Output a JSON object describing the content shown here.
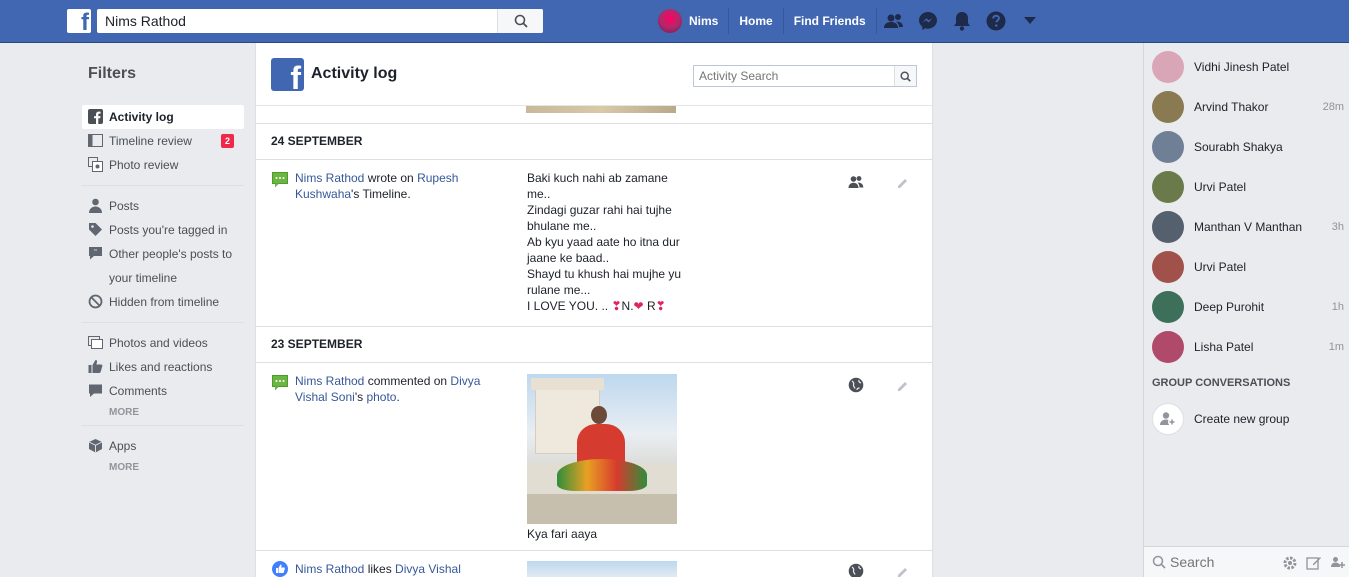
{
  "topbar": {
    "search_value": "Nims Rathod",
    "profile_name": "Nims",
    "nav_home": "Home",
    "nav_find_friends": "Find Friends"
  },
  "filters": {
    "title": "Filters",
    "items": {
      "activity_log": "Activity log",
      "timeline_review": "Timeline review",
      "timeline_review_badge": "2",
      "photo_review": "Photo review",
      "posts": "Posts",
      "posts_tagged": "Posts you're tagged in",
      "other_posts_line1": "Other people's posts to",
      "other_posts_line2": "your timeline",
      "hidden": "Hidden from timeline",
      "photos_videos": "Photos and videos",
      "likes_reactions": "Likes and reactions",
      "comments": "Comments",
      "more1": "MORE",
      "apps": "Apps",
      "more2": "MORE"
    }
  },
  "main": {
    "title": "Activity log",
    "search_placeholder": "Activity Search",
    "sections": [
      {
        "date": "24 SEPTEMBER",
        "entry": {
          "actor": "Nims Rathod",
          "verb": " wrote on ",
          "target": "Rupesh Kushwaha",
          "suffix": "'s Timeline.",
          "content_lines": [
            "Baki kuch nahi ab zamane",
            "me..",
            "Zindagi guzar rahi hai tujhe",
            "bhulane me..",
            "Ab kyu yaad aate ho itna dur",
            "jaane ke baad..",
            "Shayd tu khush hai mujhe yu",
            "rulane me...",
            "I LOVE YOU. .. "
          ],
          "content_tail_1": "N.",
          "content_tail_2": " R"
        }
      },
      {
        "date": "23 SEPTEMBER",
        "entry": {
          "actor": "Nims Rathod",
          "verb": " commented on ",
          "target": "Divya Vishal Soni",
          "suffix_mid": "'s ",
          "target2": "photo",
          "suffix": ".",
          "caption": "Kya fari aaya"
        },
        "entry2": {
          "actor": "Nims Rathod",
          "verb": " likes ",
          "target": "Divya Vishal Soni",
          "suffix": "'s"
        }
      }
    ]
  },
  "chat": {
    "friends": [
      {
        "name": "Vidhi Jinesh Patel",
        "time": "",
        "color": "#d9a6b8"
      },
      {
        "name": "Arvind Thakor",
        "time": "28m",
        "color": "#8a7a52"
      },
      {
        "name": "Sourabh Shakya",
        "time": "",
        "color": "#6f7f96"
      },
      {
        "name": "Urvi Patel",
        "time": "",
        "color": "#6b7a4a"
      },
      {
        "name": "Manthan V Manthan",
        "time": "3h",
        "color": "#55606e"
      },
      {
        "name": "Urvi Patel",
        "time": "",
        "color": "#a0524a"
      },
      {
        "name": "Deep Purohit",
        "time": "1h",
        "color": "#3e6f5a"
      },
      {
        "name": "Lisha Patel",
        "time": "1m",
        "color": "#b04a6a"
      }
    ],
    "group_header": "GROUP CONVERSATIONS",
    "create_group": "Create new group",
    "search_placeholder": "Search"
  }
}
